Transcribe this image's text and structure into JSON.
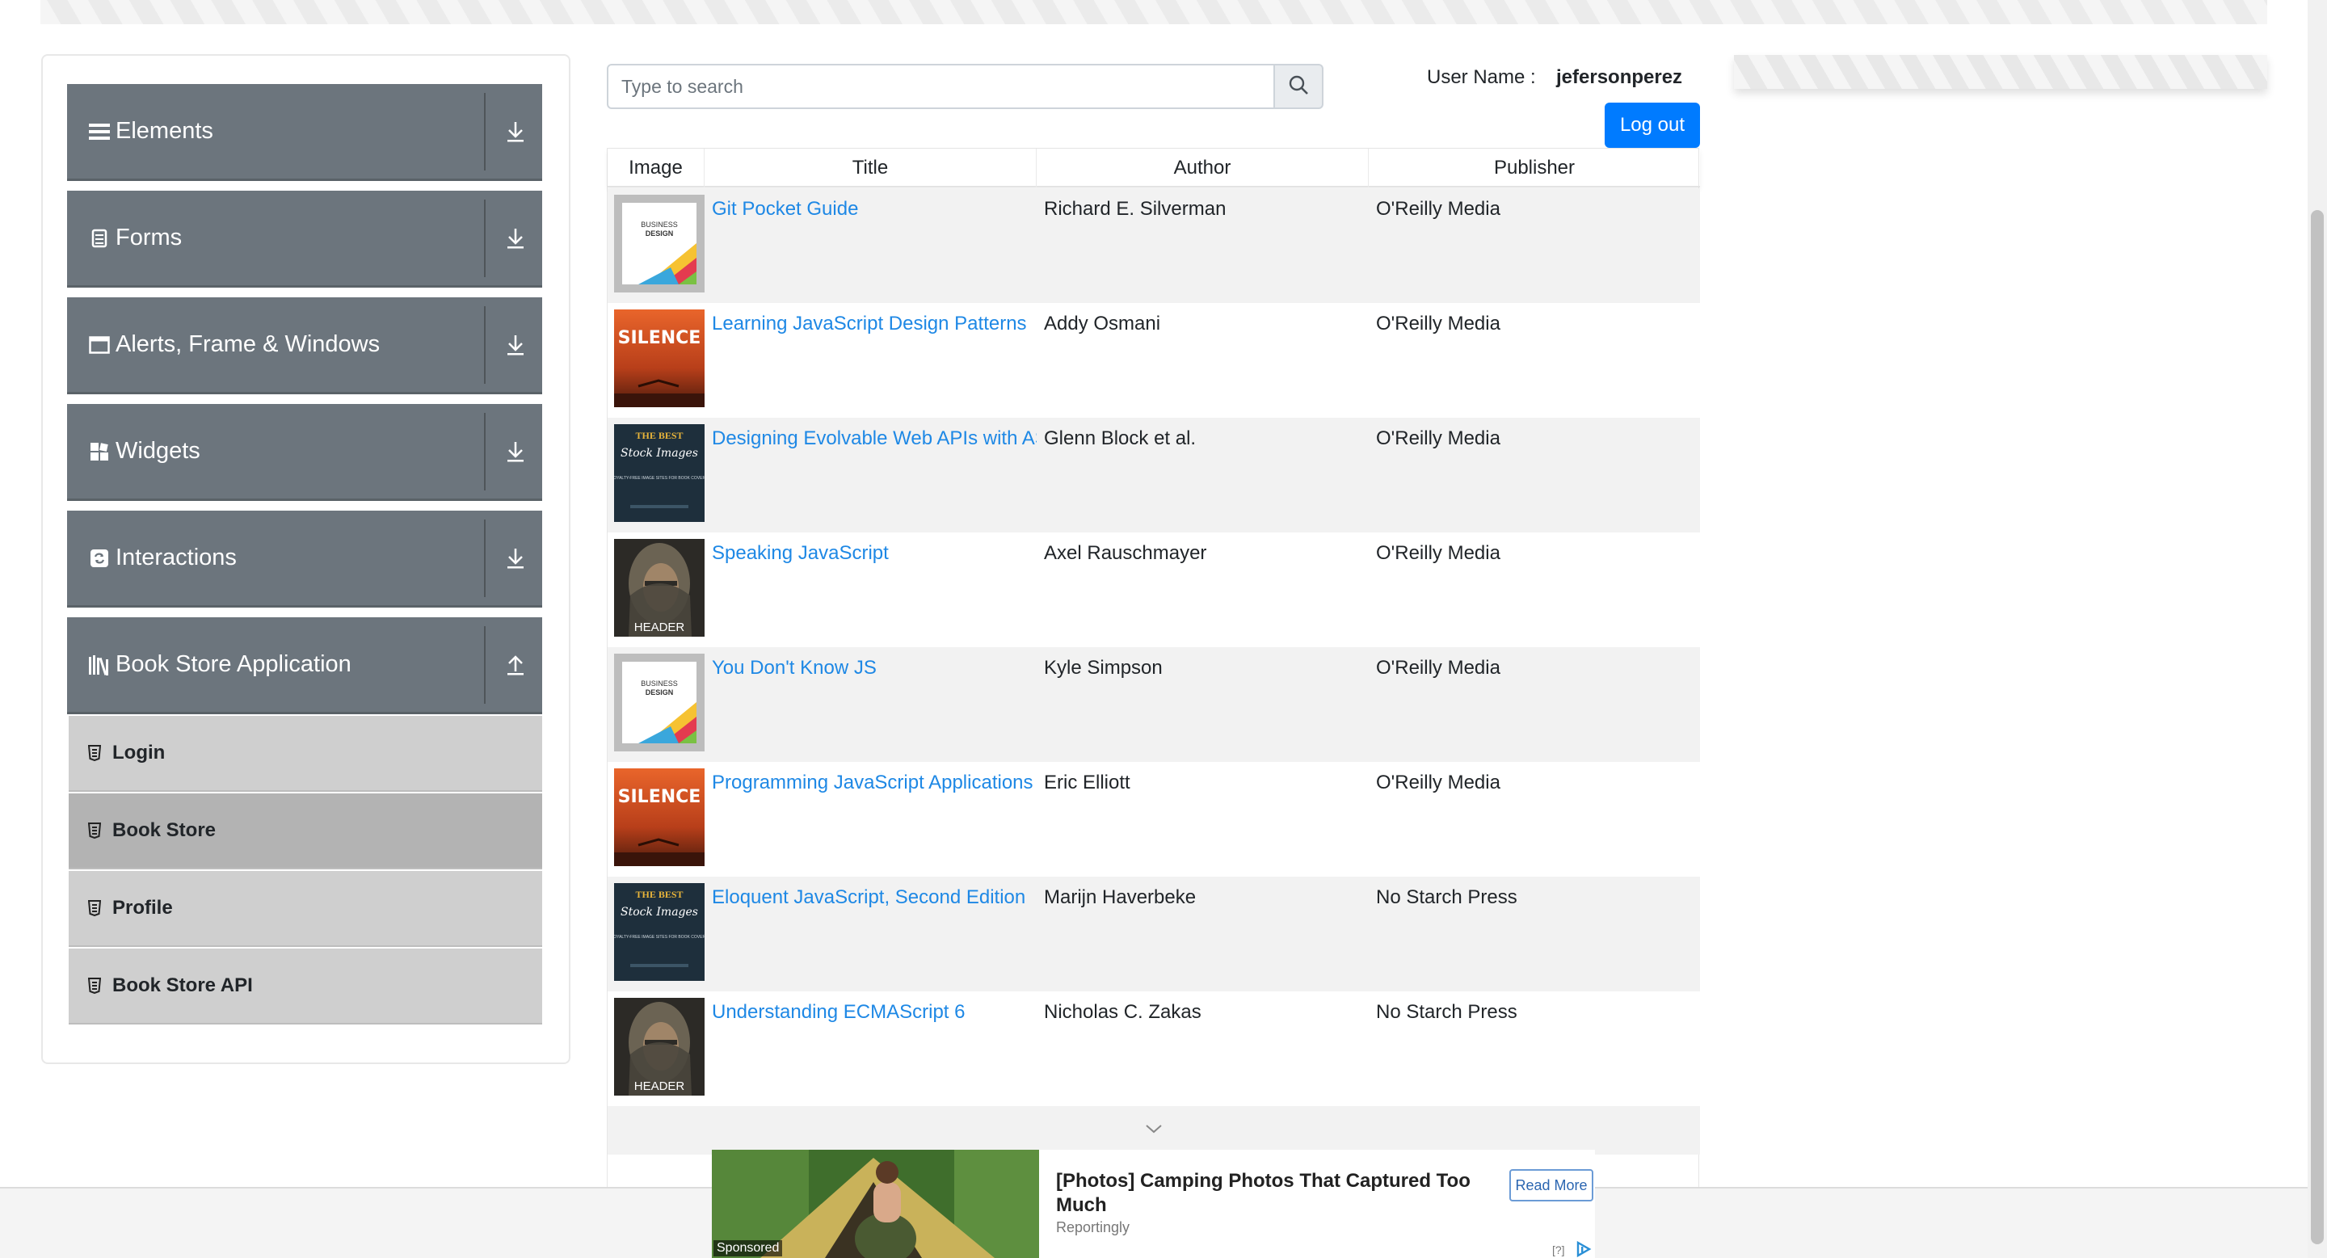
{
  "sidebar": {
    "groups": [
      {
        "label": "Elements",
        "icon": "hamburger-icon",
        "expanded": false
      },
      {
        "label": "Forms",
        "icon": "document-icon",
        "expanded": false
      },
      {
        "label": "Alerts, Frame & Windows",
        "icon": "window-icon",
        "expanded": false
      },
      {
        "label": "Widgets",
        "icon": "widgets-icon",
        "expanded": false
      },
      {
        "label": "Interactions",
        "icon": "interactions-icon",
        "expanded": false
      },
      {
        "label": "Book Store Application",
        "icon": "books-icon",
        "expanded": true
      }
    ],
    "book_store_items": [
      "Login",
      "Book Store",
      "Profile",
      "Book Store API"
    ],
    "active_item": "Book Store"
  },
  "search": {
    "placeholder": "Type to search",
    "value": ""
  },
  "user": {
    "label": "User Name :",
    "name": "jefersonperez"
  },
  "logout_label": "Log out",
  "table": {
    "headers": [
      "Image",
      "Title",
      "Author",
      "Publisher"
    ],
    "rows": [
      {
        "cover": "business-design",
        "title": "Git Pocket Guide",
        "author": "Richard E. Silverman",
        "publisher": "O'Reilly Media"
      },
      {
        "cover": "silence",
        "title": "Learning JavaScript Design Patterns",
        "author": "Addy Osmani",
        "publisher": "O'Reilly Media"
      },
      {
        "cover": "best-stock-images",
        "title": "Designing Evolvable Web APIs with AS",
        "author": "Glenn Block et al.",
        "publisher": "O'Reilly Media"
      },
      {
        "cover": "header",
        "title": "Speaking JavaScript",
        "author": "Axel Rauschmayer",
        "publisher": "O'Reilly Media"
      },
      {
        "cover": "business-design",
        "title": "You Don't Know JS",
        "author": "Kyle Simpson",
        "publisher": "O'Reilly Media"
      },
      {
        "cover": "silence",
        "title": "Programming JavaScript Applications",
        "author": "Eric Elliott",
        "publisher": "O'Reilly Media"
      },
      {
        "cover": "best-stock-images",
        "title": "Eloquent JavaScript, Second Edition",
        "author": "Marijn Haverbeke",
        "publisher": "No Starch Press"
      },
      {
        "cover": "header",
        "title": "Understanding ECMAScript 6",
        "author": "Nicholas C. Zakas",
        "publisher": "No Starch Press"
      }
    ]
  },
  "covers": {
    "business-design": {
      "small": "BUSINESS",
      "big": "DESIGN"
    },
    "silence": {
      "text": "SILENCE"
    },
    "best-stock-images": {
      "top": "THE BEST",
      "script": "Stock Images",
      "sub": "ROYALTY-FREE IMAGE SITES FOR BOOK COVERS"
    },
    "header": {
      "text": "HEADER"
    }
  },
  "ad": {
    "headline": "[Photos] Camping Photos That Captured Too Much",
    "source": "Reportingly",
    "cta": "Read More",
    "sponsored": "Sponsored",
    "info": "[?]"
  },
  "colors": {
    "sidebar_header": "#6c757d",
    "sub_item": "#cfcfcf",
    "sub_item_active": "#b3b3b3",
    "link": "#1e88e5",
    "primary_button": "#007bff",
    "row_odd": "#f2f2f2"
  }
}
